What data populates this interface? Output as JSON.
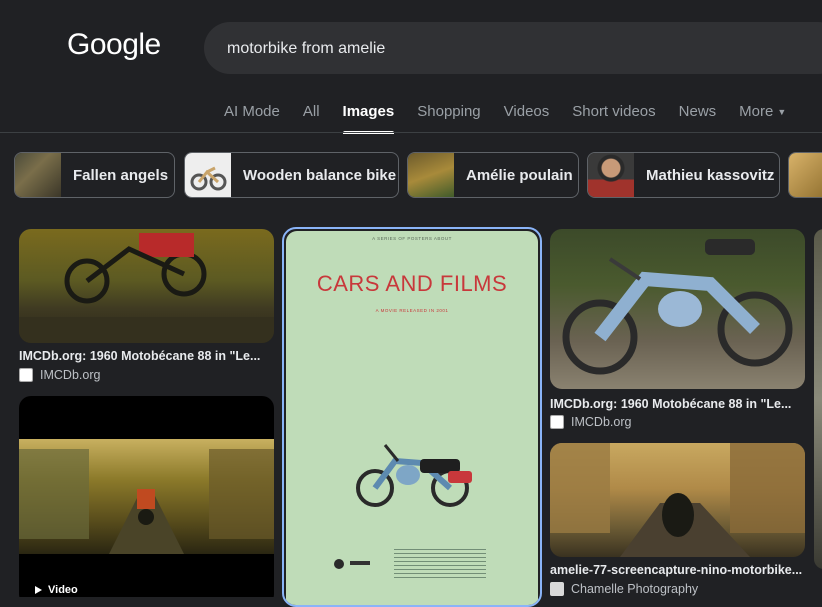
{
  "logo": "Google",
  "search": {
    "query": "motorbike from amelie"
  },
  "tabs": [
    "AI Mode",
    "All",
    "Images",
    "Shopping",
    "Videos",
    "Short videos",
    "News",
    "More"
  ],
  "chips": [
    "Fallen angels",
    "Wooden balance bike",
    "Amélie poulain",
    "Mathieu kassovitz"
  ],
  "results": [
    {
      "title": "IMCDb.org: 1960 Motobécane 88 in \"Le...",
      "source": "IMCDb.org"
    },
    {
      "badge": "Video"
    },
    {
      "poster_top": "A SERIES OF POSTERS ABOUT",
      "poster_title": "CARS AND FILMS",
      "poster_sub": "A MOVIE RELEASED IN 2001"
    },
    {
      "title": "IMCDb.org: 1960 Motobécane 88 in \"Le...",
      "source": "IMCDb.org"
    },
    {
      "title": "amelie-77-screencapture-nino-motorbike...",
      "source": "Chamelle Photography"
    }
  ],
  "colors": {
    "background": "#202124",
    "poster": "#bfdcb8",
    "poster_title": "#c8383b",
    "accent_blue": "#8ab4f8"
  }
}
